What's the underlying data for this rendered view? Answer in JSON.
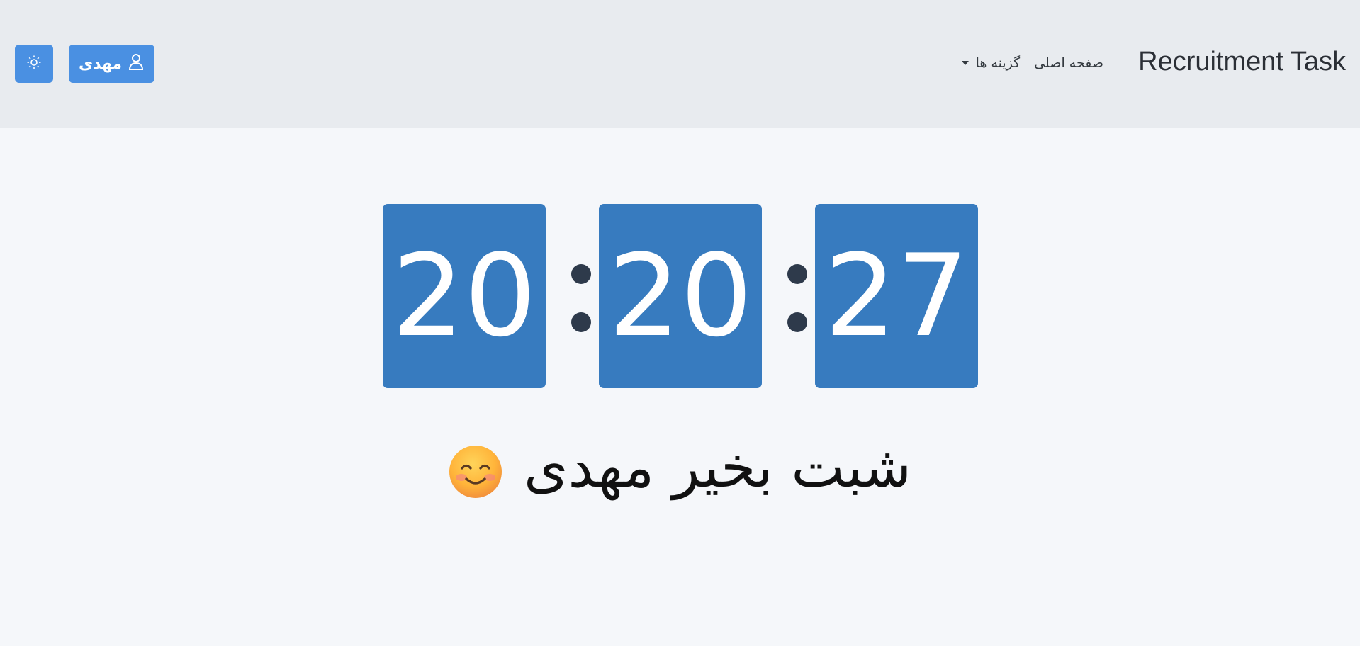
{
  "navbar": {
    "brand": "Recruitment Task",
    "links": {
      "home": "صفحه اصلی",
      "options": "گزینه ها"
    },
    "user_button_label": "مهدی",
    "theme_toggle_icon": "sun-icon",
    "user_icon": "user-icon"
  },
  "clock": {
    "hours": "20",
    "minutes": "20",
    "seconds": "27"
  },
  "greeting": {
    "text": "شبت بخیر مهدی",
    "emoji": "smiling-face-emoji"
  },
  "colors": {
    "navbar_bg": "#e8ebef",
    "page_bg": "#f5f7fa",
    "button_blue": "#4a90e2",
    "digit_card_blue": "#377bbf",
    "separator_dot": "#2e3a4b"
  }
}
